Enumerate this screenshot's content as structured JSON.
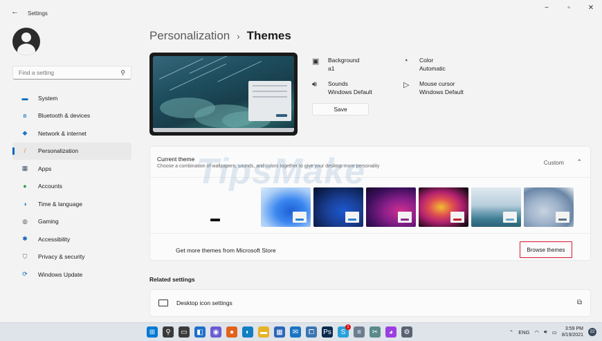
{
  "window": {
    "back_glyph": "←",
    "title": "Settings",
    "minimize_glyph": "−",
    "maximize_glyph": "▫",
    "close_glyph": "✕"
  },
  "sidebar": {
    "search_placeholder": "Find a setting",
    "search_icon": "⚲",
    "items": [
      {
        "label": "System",
        "icon": "system-icon",
        "glyph": "▬",
        "color": "#0067c0"
      },
      {
        "label": "Bluetooth & devices",
        "icon": "bluetooth-icon",
        "glyph": "ʙ",
        "color": "#0067c0"
      },
      {
        "label": "Network & internet",
        "icon": "network-icon",
        "glyph": "◆",
        "color": "#1a73c8"
      },
      {
        "label": "Personalization",
        "icon": "brush-icon",
        "glyph": "/",
        "color": "#d9863a",
        "active": true
      },
      {
        "label": "Apps",
        "icon": "apps-icon",
        "glyph": "▦",
        "color": "#44546a"
      },
      {
        "label": "Accounts",
        "icon": "accounts-icon",
        "glyph": "●",
        "color": "#2f9a4b"
      },
      {
        "label": "Time & language",
        "icon": "globe-icon",
        "glyph": "◑",
        "color": "#0b7fc4"
      },
      {
        "label": "Gaming",
        "icon": "gaming-icon",
        "glyph": "◍",
        "color": "#666666"
      },
      {
        "label": "Accessibility",
        "icon": "accessibility-icon",
        "glyph": "✱",
        "color": "#0a5fb4"
      },
      {
        "label": "Privacy & security",
        "icon": "shield-icon",
        "glyph": "⛉",
        "color": "#666666"
      },
      {
        "label": "Windows Update",
        "icon": "update-icon",
        "glyph": "⟳",
        "color": "#0b68c2"
      }
    ]
  },
  "breadcrumb": {
    "parent": "Personalization",
    "separator": "›",
    "current": "Themes"
  },
  "properties": {
    "background": {
      "label": "Background",
      "value": "a1",
      "glyph": "▣"
    },
    "color": {
      "label": "Color",
      "value": "Automatic",
      "glyph": "◔"
    },
    "sounds": {
      "label": "Sounds",
      "value": "Windows Default",
      "glyph": "🔊︎"
    },
    "mouse": {
      "label": "Mouse cursor",
      "value": "Windows Default",
      "glyph": "▷"
    },
    "save_label": "Save"
  },
  "current_theme": {
    "title": "Current theme",
    "subtitle": "Choose a combination of wallpapers, sounds, and colors together to give your desktop more personality",
    "value": "Custom",
    "chevron": "⌃",
    "themes": [
      {
        "name": "theme-blank",
        "accent": "#111111"
      },
      {
        "name": "theme-windows-light",
        "accent": "#2a7fd0"
      },
      {
        "name": "theme-windows-dark",
        "accent": "#2a7fd0"
      },
      {
        "name": "theme-glow",
        "accent": "#8a2a8a"
      },
      {
        "name": "theme-captured-motion",
        "accent": "#c4202a"
      },
      {
        "name": "theme-sunrise",
        "accent": "#6aa7c8"
      },
      {
        "name": "theme-flow",
        "accent": "#5b6f82"
      }
    ],
    "store_text": "Get more themes from Microsoft Store",
    "browse_label": "Browse themes"
  },
  "related": {
    "title": "Related settings",
    "desktop_icon_settings": "Desktop icon settings",
    "external_glyph": "⧉"
  },
  "watermark": "TipsMake",
  "taskbar": {
    "apps": [
      {
        "name": "start-icon",
        "glyph": "⊞",
        "bg": "#0078d4"
      },
      {
        "name": "search-icon",
        "glyph": "⚲",
        "bg": "#3a3a3a"
      },
      {
        "name": "task-view-icon",
        "glyph": "▭",
        "bg": "#3a3a3a"
      },
      {
        "name": "widgets-icon",
        "glyph": "◧",
        "bg": "#1f6fc9"
      },
      {
        "name": "chat-icon",
        "glyph": "◉",
        "bg": "#6b5bd1"
      },
      {
        "name": "firefox-icon",
        "glyph": "●",
        "bg": "#e2621b"
      },
      {
        "name": "edge-icon",
        "glyph": "◐",
        "bg": "#0f7fc1"
      },
      {
        "name": "explorer-icon",
        "glyph": "▬",
        "bg": "#e7b326"
      },
      {
        "name": "store-icon",
        "glyph": "▦",
        "bg": "#2a66b8"
      },
      {
        "name": "mail-icon",
        "glyph": "✉",
        "bg": "#1a74c4"
      },
      {
        "name": "photos-icon",
        "glyph": "⧠",
        "bg": "#3b74b2"
      },
      {
        "name": "photoshop-icon",
        "glyph": "Ps",
        "bg": "#0a2b4e"
      },
      {
        "name": "skype-icon",
        "glyph": "S",
        "bg": "#2aa0da",
        "badge": "1"
      },
      {
        "name": "notes-icon",
        "glyph": "≡",
        "bg": "#6b7d8f"
      },
      {
        "name": "snip-icon",
        "glyph": "✂",
        "bg": "#5a8a8a"
      },
      {
        "name": "messenger-icon",
        "glyph": "◕",
        "bg": "#9b3fe0"
      },
      {
        "name": "settings-icon",
        "glyph": "⚙",
        "bg": "#586270"
      }
    ],
    "tray_chevron": "⌃",
    "language": "ENG",
    "wifi_glyph": "◠",
    "volume_glyph": "🔊︎",
    "battery_glyph": "▭",
    "time": "3:59 PM",
    "date": "8/19/2021",
    "notifications": "22"
  }
}
